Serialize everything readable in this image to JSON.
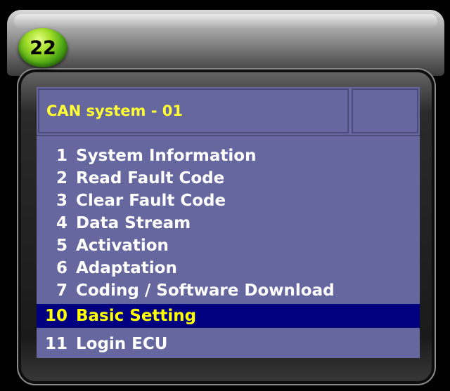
{
  "badge": {
    "number": "22"
  },
  "header": {
    "title": "CAN system - 01",
    "aux": ""
  },
  "menu": {
    "items": [
      {
        "number": "1",
        "label": "System Information",
        "selected": false
      },
      {
        "number": "2",
        "label": "Read Fault Code",
        "selected": false
      },
      {
        "number": "3",
        "label": "Clear Fault Code",
        "selected": false
      },
      {
        "number": "4",
        "label": "Data Stream",
        "selected": false
      },
      {
        "number": "5",
        "label": "Activation",
        "selected": false
      },
      {
        "number": "6",
        "label": "Adaptation",
        "selected": false
      },
      {
        "number": "7",
        "label": "Coding / Software Download",
        "selected": false
      },
      {
        "number": "10",
        "label": "Basic Setting",
        "selected": true
      },
      {
        "number": "11",
        "label": "Login ECU",
        "selected": false
      }
    ]
  },
  "colors": {
    "panel_background": "#6767a0",
    "title_text": "#ffff33",
    "menu_text": "#ffffff",
    "selected_background": "#000080",
    "selected_text": "#ffff00",
    "badge": "#4aa414"
  }
}
